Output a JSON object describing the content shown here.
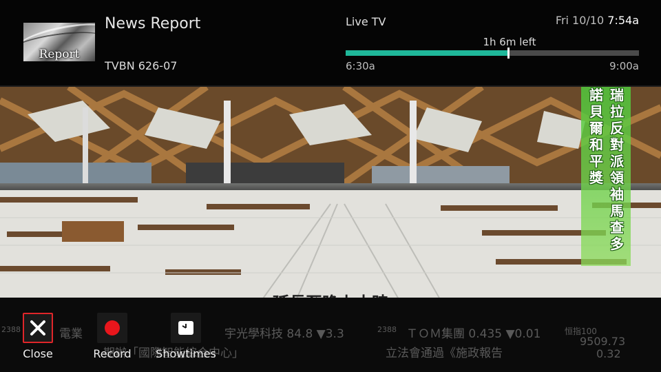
{
  "header": {
    "thumbnail_text": "Report",
    "show_title": "News Report",
    "channel": "TVBN 626-07",
    "live_label": "Live TV",
    "date": "Fri 10/10",
    "time": "7:54a",
    "time_left": "1h 6m left",
    "start_time": "6:30a",
    "end_time": "9:00a",
    "progress_fraction": 0.555,
    "progress_color": "#1fb89a"
  },
  "video": {
    "vertical_caption_col1": "諾貝爾和平獎",
    "vertical_caption_col2": "瑞拉反對派領袖馬查多",
    "subtitle": "延長至晚上十時",
    "ticker": [
      "2388",
      "電業",
      "宇光學科技 84.8 ▼3.3",
      "2388",
      "ＴＯＭ集團 0.435 ▼0.01",
      "恒指100",
      "9509.73",
      "0.32",
      "期辦「國際智能綜合中心」",
      "立法會通過《施政報告"
    ]
  },
  "controls": {
    "close_label": "Close",
    "record_label": "Record",
    "showtimes_label": "Showtimes",
    "close_icon": "close-x-icon",
    "record_icon": "record-dot-icon",
    "showtimes_icon": "clock-icon",
    "close_border_color": "#e0262a",
    "record_color": "#e8161c"
  }
}
